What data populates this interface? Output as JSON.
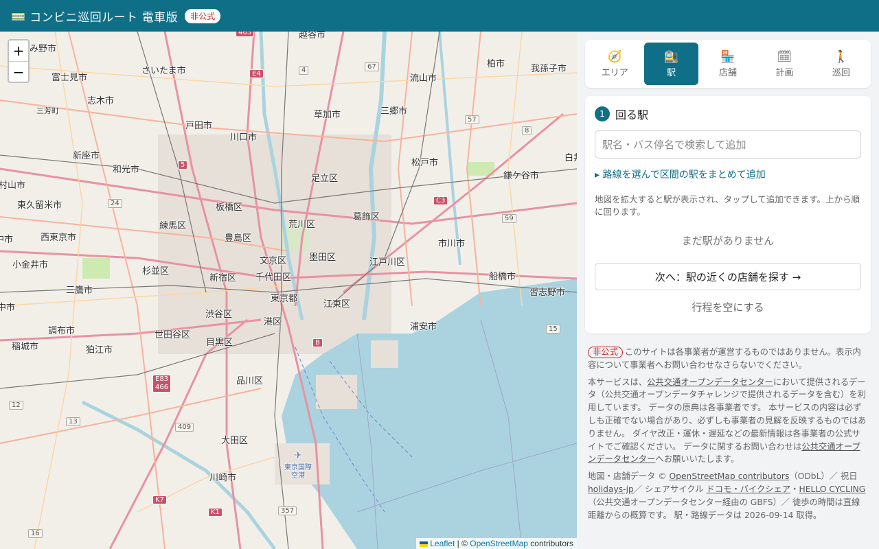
{
  "header": {
    "title": "コンビニ巡回ルート 電車版",
    "icon": "train-icon",
    "badge": "非公式",
    "color": "#0e6f86"
  },
  "map": {
    "zoom_in": "+",
    "zoom_out": "−",
    "attribution": {
      "leaflet": "Leaflet",
      "sep": " | © ",
      "osm": "OpenStreetMap",
      "contributors": " contributors"
    },
    "places": [
      {
        "name": "さいたま市"
      },
      {
        "name": "富士見市"
      },
      {
        "name": "志木市"
      },
      {
        "name": "三芳町"
      },
      {
        "name": "新座市"
      },
      {
        "name": "和光市"
      },
      {
        "name": "戸田市"
      },
      {
        "name": "川口市"
      },
      {
        "name": "草加市"
      },
      {
        "name": "三郷市"
      },
      {
        "name": "流山市"
      },
      {
        "name": "柏市"
      },
      {
        "name": "我孫子市"
      },
      {
        "name": "松戸市"
      },
      {
        "name": "鎌ケ谷市"
      },
      {
        "name": "足立区"
      },
      {
        "name": "板橋区"
      },
      {
        "name": "練馬区"
      },
      {
        "name": "荒川区"
      },
      {
        "name": "葛飾区"
      },
      {
        "name": "東久留米市"
      },
      {
        "name": "西東京市"
      },
      {
        "name": "豊島区"
      },
      {
        "name": "文京区"
      },
      {
        "name": "墨田区"
      },
      {
        "name": "江戸川区"
      },
      {
        "name": "市川市"
      },
      {
        "name": "小金井市"
      },
      {
        "name": "杉並区"
      },
      {
        "name": "新宿区"
      },
      {
        "name": "千代田区"
      },
      {
        "name": "船橋市"
      },
      {
        "name": "三鷹市"
      },
      {
        "name": "東京都"
      },
      {
        "name": "江東区"
      },
      {
        "name": "習志野市"
      },
      {
        "name": "渋谷区"
      },
      {
        "name": "港区"
      },
      {
        "name": "浦安市"
      },
      {
        "name": "調布市"
      },
      {
        "name": "世田谷区"
      },
      {
        "name": "目黒区"
      },
      {
        "name": "稲城市"
      },
      {
        "name": "狛江市"
      },
      {
        "name": "品川区"
      },
      {
        "name": "大田区"
      },
      {
        "name": "川崎市"
      },
      {
        "name": "越谷市"
      },
      {
        "name": "じみ野市"
      },
      {
        "name": "村山市"
      },
      {
        "name": "中市"
      },
      {
        "name": "白井"
      }
    ],
    "airport": "東京国際空港"
  },
  "tabs": [
    {
      "label": "エリア",
      "icon": "🧭"
    },
    {
      "label": "駅",
      "icon": "🚉"
    },
    {
      "label": "店舗",
      "icon": "🏪"
    },
    {
      "label": "計画",
      "icon": "🗓"
    },
    {
      "label": "巡回",
      "icon": "🚶"
    }
  ],
  "active_tab": "駅",
  "stations": {
    "step": "1",
    "heading": "回る駅",
    "search_placeholder": "駅名・バス停名で検索して追加",
    "route_link": "▸ 路線を選んで区間の駅をまとめて追加",
    "hint": "地図を拡大すると駅が表示され、タップして追加できます。上から順に回ります。",
    "empty": "まだ駅がありません",
    "next_button": "次へ：駅の近くの店舗を探す →",
    "clear_button": "行程を空にする"
  },
  "notes": {
    "badge": "非公式",
    "disclaimer": "このサイトは各事業者が運営するものではありません。表示内容について事業者へお問い合わせなさらないでください。",
    "odpt_1": "本サービスは、",
    "odpt_link": "公共交通オープンデータセンター",
    "odpt_2": "において提供されるデータ（公共交通オープンデータチャレンジで提供されるデータを含む）を利用しています。 データの原典は各事業者です。 本サービスの内容は必ずしも正確でない場合があり、必ずしも事業者の見解を反映するものではありません。 ダイヤ改正・運休・遅延などの最新情報は各事業者の公式サイトでご確認ください。 データに関するお問い合わせは",
    "odpt_link2": "公共交通オープンデータセンター",
    "odpt_3": "へお願いいたします。",
    "credit_1": "地図・店舗データ © ",
    "osm_link": "OpenStreetMap contributors",
    "credit_2": "（ODbL）／ 祝日 ",
    "holidays_link": "holidays-jp",
    "credit_3": "／ シェアサイクル ",
    "docomo_link": "ドコモ・バイクシェア",
    "credit_4": "・",
    "hello_link": "HELLO CYCLING",
    "credit_5": "（公共交通オープンデータセンター経由の GBFS）／ 徒歩の時間は直線距離からの概算です。 駅・路線データは 2026-09-14 取得。"
  }
}
